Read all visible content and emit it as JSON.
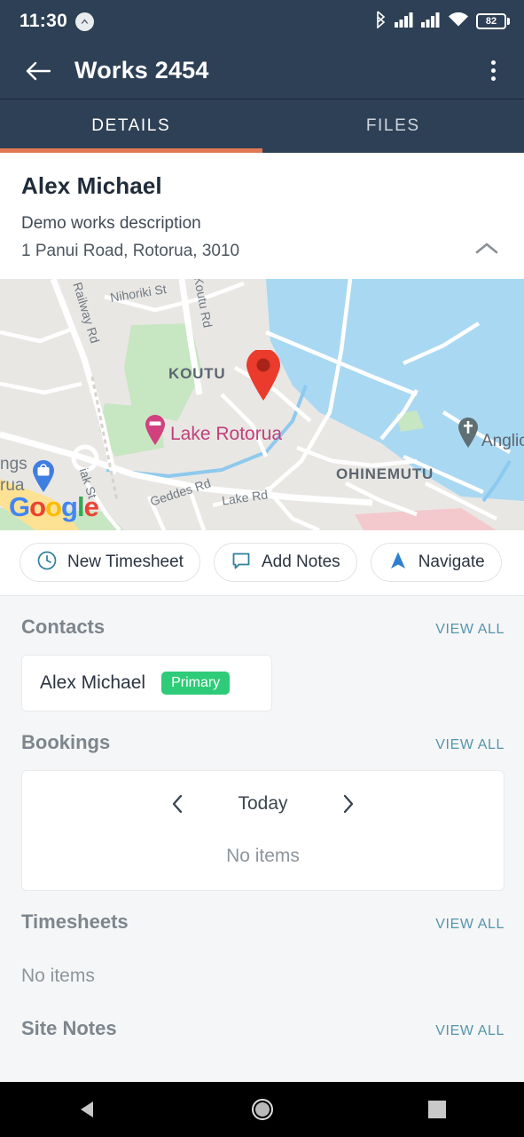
{
  "statusbar": {
    "time": "11:30",
    "badge_icon": "caret-up-circle-icon",
    "bluetooth_icon": "bluetooth-icon",
    "signal1_icon": "cellular-signal-icon",
    "signal2_icon": "cellular-signal-icon",
    "wifi_icon": "wifi-icon",
    "battery_level": "82",
    "battery_icon": "battery-icon"
  },
  "appbar": {
    "back_icon": "back-arrow-icon",
    "title": "Works 2454",
    "overflow_icon": "overflow-menu-icon"
  },
  "tabs": {
    "items": [
      {
        "label": "DETAILS",
        "active": true
      },
      {
        "label": "FILES",
        "active": false
      }
    ],
    "indicator_color": "#e07856"
  },
  "detail_header": {
    "name": "Alex Michael",
    "description": "Demo works description",
    "address": "1 Panui Road, Rotorua, 3010",
    "collapse_icon": "chevron-up-icon"
  },
  "map": {
    "provider_logo": "Google",
    "provider_letters": [
      "G",
      "o",
      "o",
      "g",
      "l",
      "e"
    ],
    "marker_icon": "map-pin-icon",
    "labels": [
      {
        "text": "Nihoriki St",
        "type": "street"
      },
      {
        "text": "Railway Rd",
        "type": "street"
      },
      {
        "text": "Koutu Rd",
        "type": "street"
      },
      {
        "text": "KOUTU",
        "type": "suburb"
      },
      {
        "text": "OHINEMUTU",
        "type": "suburb"
      },
      {
        "text": "Lake Rotorua",
        "type": "water"
      },
      {
        "text": "Geddes Rd",
        "type": "street"
      },
      {
        "text": "Lake Rd",
        "type": "street"
      },
      {
        "text": "iak St",
        "type": "street"
      },
      {
        "text": "Anglic",
        "type": "poi"
      },
      {
        "text": "ngs",
        "type": "shop"
      },
      {
        "text": "rua",
        "type": "shop"
      }
    ],
    "poi_markers": [
      {
        "name": "lake-poi-marker",
        "icon": "bed-icon",
        "color": "#d0417e"
      },
      {
        "name": "church-poi-marker",
        "icon": "cross-icon",
        "color": "#5f6f73"
      },
      {
        "name": "shop-poi-marker",
        "icon": "bag-icon",
        "color": "#3f7de0"
      }
    ]
  },
  "actions": [
    {
      "label": "New Timesheet",
      "icon": "clock-icon"
    },
    {
      "label": "Add Notes",
      "icon": "comment-icon"
    },
    {
      "label": "Navigate",
      "icon": "navigation-arrow-icon"
    }
  ],
  "sections": {
    "contacts": {
      "title": "Contacts",
      "view_all": "VIEW ALL",
      "items": [
        {
          "name": "Alex Michael",
          "badge": "Primary",
          "badge_color": "#2ecc78"
        }
      ]
    },
    "bookings": {
      "title": "Bookings",
      "view_all": "VIEW ALL",
      "prev_icon": "chevron-left-icon",
      "date_label": "Today",
      "next_icon": "chevron-right-icon",
      "empty_text": "No items"
    },
    "timesheets": {
      "title": "Timesheets",
      "view_all": "VIEW ALL",
      "empty_text": "No items"
    },
    "site_notes": {
      "title": "Site Notes",
      "view_all": "VIEW ALL"
    }
  },
  "navbar": {
    "back_icon": "nav-back-triangle-icon",
    "home_icon": "nav-home-circle-icon",
    "recents_icon": "nav-recents-square-icon"
  },
  "colors": {
    "appbar": "#2e4055",
    "accent": "#e07856",
    "link": "#5695ad",
    "badge_green": "#2ecc78",
    "chip_icon": "#2f7f9e"
  }
}
